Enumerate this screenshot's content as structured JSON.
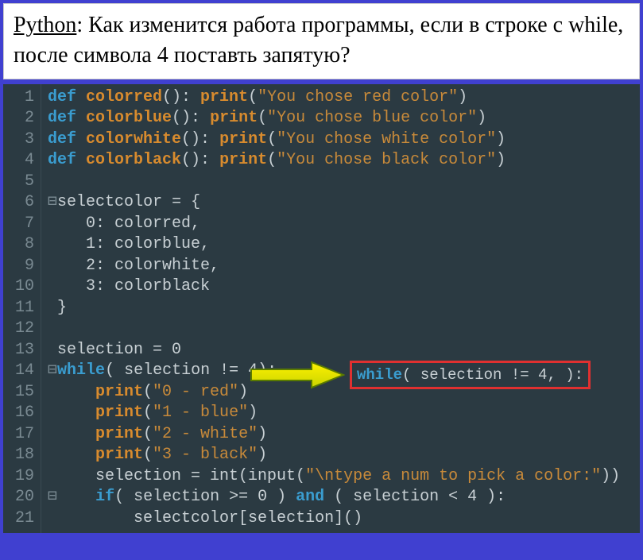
{
  "question": {
    "label": "Python",
    "text": ": Как изменится работа программы, если в строке с while, после символа  4 поставть запятую?"
  },
  "gutter": [
    "1",
    "2",
    "3",
    "4",
    "5",
    "6",
    "7",
    "8",
    "9",
    "10",
    "11",
    "12",
    "13",
    "14",
    "15",
    "16",
    "17",
    "18",
    "19",
    "20",
    "21"
  ],
  "code": {
    "l1": {
      "def": "def ",
      "name": "colorred",
      "mid": "(): ",
      "print": "print",
      "open": "(",
      "str": "\"You chose red color\"",
      "close": ")"
    },
    "l2": {
      "def": "def ",
      "name": "colorblue",
      "mid": "(): ",
      "print": "print",
      "open": "(",
      "str": "\"You chose blue color\"",
      "close": ")"
    },
    "l3": {
      "def": "def ",
      "name": "colorwhite",
      "mid": "(): ",
      "print": "print",
      "open": "(",
      "str": "\"You chose white color\"",
      "close": ")"
    },
    "l4": {
      "def": "def ",
      "name": "colorblack",
      "mid": "(): ",
      "print": "print",
      "open": "(",
      "str": "\"You chose black color\"",
      "close": ")"
    },
    "l6": "selectcolor = {",
    "l7": "    0: colorred,",
    "l8": "    1: colorblue,",
    "l9": "    2: colorwhite,",
    "l10": "    3: colorblack",
    "l11": "}",
    "l13": "selection = 0",
    "l14": {
      "while": "while",
      "rest": "( selection != 4):"
    },
    "l15": {
      "print": "print",
      "open": "(",
      "str": "\"0 - red\"",
      "close": ")"
    },
    "l16": {
      "print": "print",
      "open": "(",
      "str": "\"1 - blue\"",
      "close": ")"
    },
    "l17": {
      "print": "print",
      "open": "(",
      "str": "\"2 - white\"",
      "close": ")"
    },
    "l18": {
      "print": "print",
      "open": "(",
      "str": "\"3 - black\"",
      "close": ")"
    },
    "l19": {
      "a": "selection = int(input(",
      "str": "\"\\ntype a num to pick a color:\"",
      "b": "))"
    },
    "l20": {
      "if": "if",
      "a": "( selection >= 0 ) ",
      "and": "and",
      "b": " ( selection < 4 ):"
    },
    "l21": "selectcolor[selection]()"
  },
  "callout": {
    "while": "while",
    "rest": "( selection != 4, ):"
  }
}
